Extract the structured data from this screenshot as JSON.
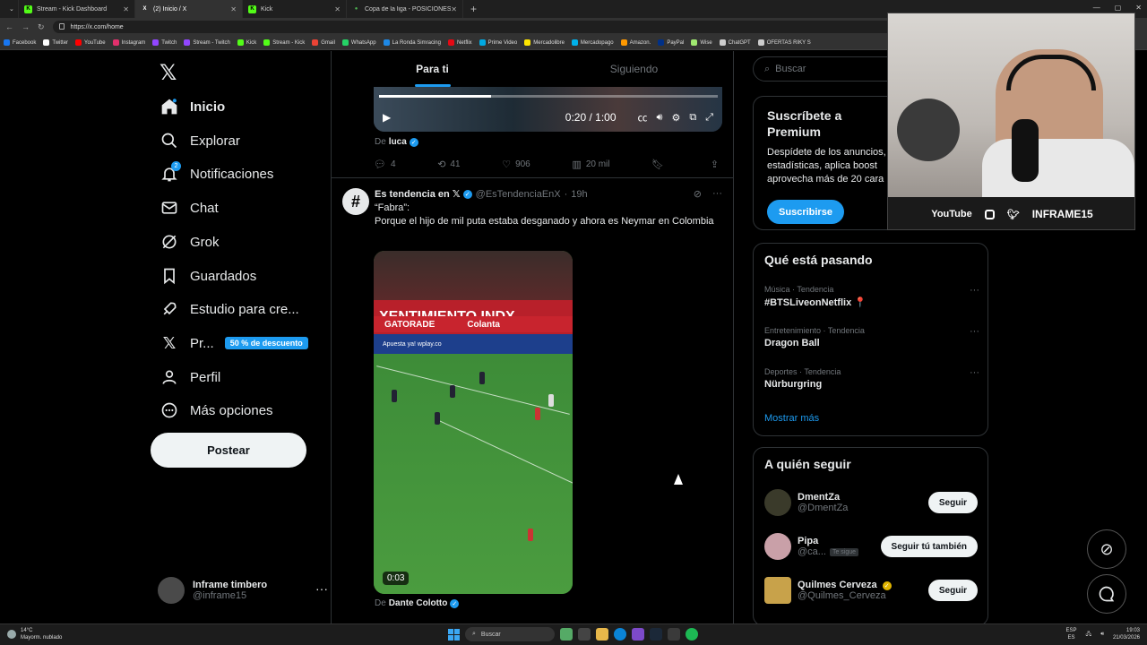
{
  "browser": {
    "tabs": [
      {
        "label": "Stream - Kick Dashboard",
        "favicon_color": "#53fc18",
        "favicon_glyph": "K"
      },
      {
        "label": "(2) Inicio / X",
        "favicon_color": "#ffffff",
        "favicon_glyph": "X"
      },
      {
        "label": "Kick",
        "favicon_color": "#53fc18",
        "favicon_glyph": "K"
      },
      {
        "label": "Copa de la liga - POSICIONES, RE...",
        "favicon_color": "#4caf50",
        "favicon_glyph": "●"
      }
    ],
    "url": "https://x.com/home",
    "bookmarks": [
      {
        "label": "Facebook",
        "color": "#1877f2"
      },
      {
        "label": "Twitter",
        "color": "#ffffff"
      },
      {
        "label": "YouTube",
        "color": "#ff0000"
      },
      {
        "label": "Instagram",
        "color": "#e1306c"
      },
      {
        "label": "Twitch",
        "color": "#9146ff"
      },
      {
        "label": "Stream - Twitch",
        "color": "#9146ff"
      },
      {
        "label": "Kick",
        "color": "#53fc18"
      },
      {
        "label": "Stream - Kick",
        "color": "#53fc18"
      },
      {
        "label": "Gmail",
        "color": "#ea4335"
      },
      {
        "label": "WhatsApp",
        "color": "#25d366"
      },
      {
        "label": "La Ronda Simracing",
        "color": "#1e88e5"
      },
      {
        "label": "Netflix",
        "color": "#e50914"
      },
      {
        "label": "Prime Video",
        "color": "#00a8e1"
      },
      {
        "label": "Mercadolibre",
        "color": "#ffe600"
      },
      {
        "label": "Mercadopago",
        "color": "#00b1ea"
      },
      {
        "label": "Amazon.",
        "color": "#ff9900"
      },
      {
        "label": "PayPal",
        "color": "#003087"
      },
      {
        "label": "Wise",
        "color": "#9fe870"
      },
      {
        "label": "ChatGPT",
        "color": "#cccccc"
      },
      {
        "label": "OFERTAS RIKY S",
        "color": "#cccccc"
      }
    ]
  },
  "nav": {
    "items": [
      {
        "label": "Inicio",
        "icon": "home-icon"
      },
      {
        "label": "Explorar",
        "icon": "search-icon"
      },
      {
        "label": "Notificaciones",
        "icon": "bell-icon",
        "badge": "2"
      },
      {
        "label": "Chat",
        "icon": "mail-icon"
      },
      {
        "label": "Grok",
        "icon": "grok-icon"
      },
      {
        "label": "Guardados",
        "icon": "bookmark-icon"
      },
      {
        "label": "Estudio para cre...",
        "icon": "rocket-icon"
      },
      {
        "label": "Pr...",
        "icon": "x-premium-icon",
        "badge": "50 % de descuento"
      },
      {
        "label": "Perfil",
        "icon": "person-icon"
      },
      {
        "label": "Más opciones",
        "icon": "more-circle-icon"
      }
    ],
    "post_label": "Postear",
    "user_name": "Inframe timbero",
    "user_handle": "@inframe15"
  },
  "feed": {
    "tabs": [
      "Para ti",
      "Siguiendo"
    ],
    "tweet1": {
      "video_time": "0:20 / 1:00",
      "from_prefix": "De",
      "from_user": "luca",
      "replies": "4",
      "retweets": "41",
      "likes": "906",
      "views": "20 mil"
    },
    "tweet2": {
      "name": "Es tendencia en 𝕏",
      "handle": "@EsTendenciaEnX",
      "time": "19h",
      "text_line1": "“Fabra”:",
      "text_line2": "Porque el hijo de mil puta estaba desganado y ahora es Neymar en Colombia",
      "video_duration": "0:03",
      "board_text": "XENTIMIENTO INDX",
      "board_brand": "GATORADE",
      "board_colanta": "Colanta",
      "ads_text": "Apuesta ya! wplay.co",
      "from_prefix": "De",
      "from_user": "Dante Colotto"
    }
  },
  "right": {
    "search_placeholder": "Buscar",
    "premium_title": "Suscríbete a Premium",
    "premium_text": "Despídete de los anuncios, estadísticas, aplica boost aprovecha más de 20 cara",
    "premium_button": "Suscribirse",
    "trending_title": "Qué está pasando",
    "trends": [
      {
        "category": "Música · Tendencia",
        "title": "#BTSLiveonNetflix 📍"
      },
      {
        "category": "Entretenimiento · Tendencia",
        "title": "Dragon Ball"
      },
      {
        "category": "Deportes · Tendencia",
        "title": "Nürburgring"
      }
    ],
    "show_more": "Mostrar más",
    "follow_title": "A quién seguir",
    "follow": [
      {
        "name": "DmentZa",
        "handle": "@DmentZa",
        "button": "Seguir",
        "avatar_color": "#3a3a2a",
        "tag": ""
      },
      {
        "name": "Pipa",
        "handle": "@ca...",
        "button": "Seguir tú también",
        "avatar_color": "#c9a0a8",
        "tag": "Te sigue"
      },
      {
        "name": "Quilmes Cerveza",
        "handle": "@Quilmes_Cerveza",
        "button": "Seguir",
        "avatar_color": "#c8a24a",
        "tag": ""
      }
    ]
  },
  "webcam": {
    "youtube": "YouTube",
    "channel": "INFRAME15"
  },
  "taskbar": {
    "temp": "14°C",
    "weather": "Mayorm. nublado",
    "search": "Buscar",
    "lang1": "ESP",
    "lang2": "ES",
    "time": "19:03",
    "date": "21/03/2026"
  },
  "colors": {
    "accent": "#1d9bf0",
    "text": "#e7e9ea",
    "muted": "#71767b",
    "border": "#2f3336"
  }
}
